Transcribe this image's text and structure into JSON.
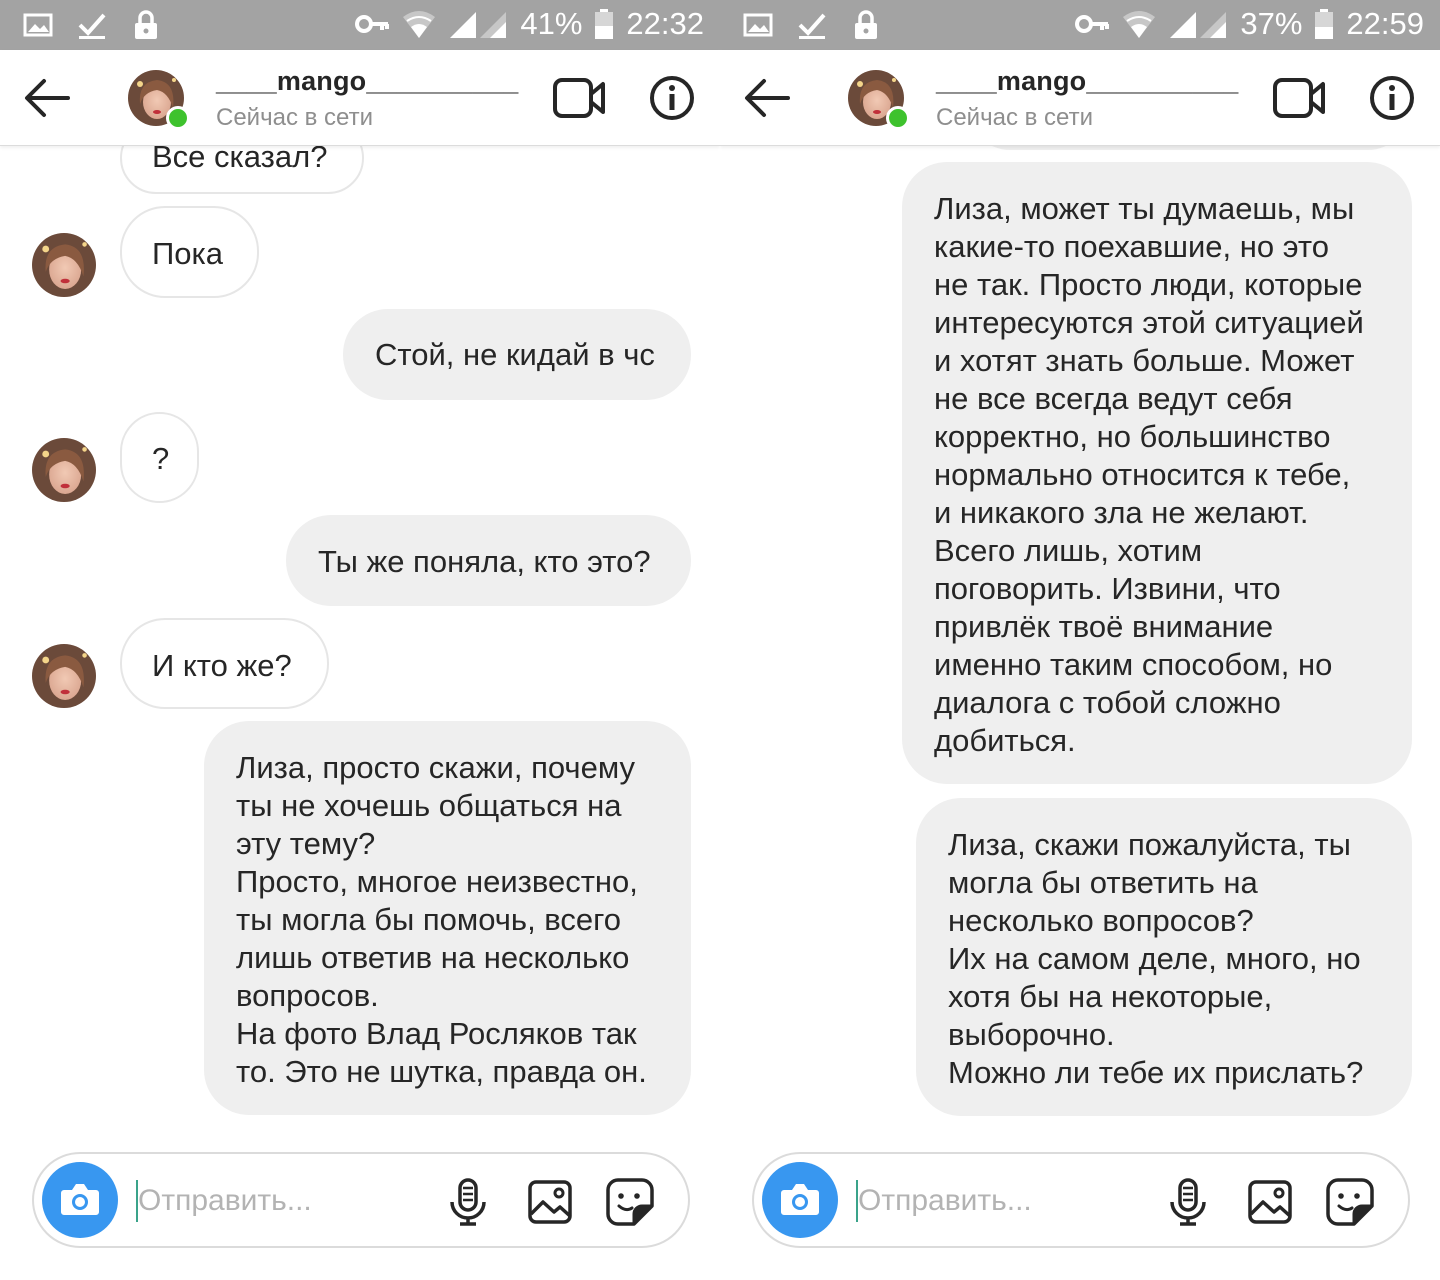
{
  "left": {
    "status_bar": {
      "battery": "41%",
      "time": "22:32"
    },
    "header": {
      "username": "____mango__________",
      "status": "Сейчас в сети"
    },
    "messages": {
      "m0": "Все сказал?",
      "m1": "Пока",
      "m2": "Стой, не кидай в чс",
      "m3": "?",
      "m4": "Ты же поняла, кто это?",
      "m5": "И кто же?",
      "m6": "Лиза, просто скажи, почему\nты не хочешь общаться на\nэту тему?\nПросто, многое неизвестно,\nты могла бы помочь, всего\nлишь ответив на несколько\nвопросов.\nНа фото Влад Росляков так\nто. Это не шутка, правда он."
    },
    "composer": {
      "placeholder": "Отправить..."
    }
  },
  "right": {
    "status_bar": {
      "battery": "37%",
      "time": "22:59"
    },
    "header": {
      "username": "____mango__________",
      "status": "Сейчас в сети"
    },
    "messages": {
      "m1": "Лиза, может ты думаешь, мы\nкакие-то поехавшие, но это\nне так. Просто люди, которые\nинтересуются этой ситуацией\nи хотят знать больше. Может\nне все всегда ведут себя\nкорректно, но большинство\nнормально относится к тебе,\nи никакого зла не желают.\nВсего лишь, хотим\nпоговорить. Извини, что\nпривлёк твоё внимание\nименно таким способом, но\nдиалога с тобой сложно\nдобиться.",
      "m2": "Лиза, скажи пожалуйста, ты\nмогла бы ответить на\nнесколько вопросов?\nИх на самом деле, много, но\nхотя бы на некоторые,\nвыборочно.\nМожно ли тебе их прислать?"
    },
    "composer": {
      "placeholder": "Отправить..."
    }
  },
  "colors": {
    "status_bar": "#a3a3a3",
    "outgoing_bubble": "#efefef",
    "incoming_border": "#e6e6e6",
    "online": "#3ec22d",
    "camera_button": "#3897f0"
  },
  "icons": {
    "status_left": [
      "image-icon",
      "check-icon",
      "lock-icon"
    ],
    "status_right": [
      "vpn-key-icon",
      "wifi-icon",
      "signal-icon",
      "battery-icon"
    ],
    "header": [
      "back-arrow-icon",
      "video-call-icon",
      "info-icon"
    ],
    "composer": [
      "camera-icon",
      "microphone-icon",
      "gallery-icon",
      "sticker-icon"
    ]
  }
}
